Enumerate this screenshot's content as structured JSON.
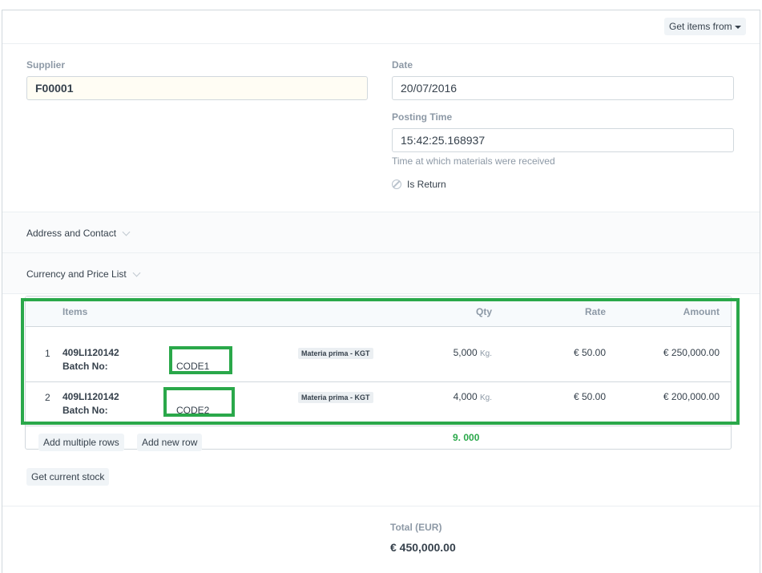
{
  "toolbar": {
    "get_items_label": "Get items from"
  },
  "supplier": {
    "label": "Supplier",
    "value": "F00001"
  },
  "date": {
    "label": "Date",
    "value": "20/07/2016"
  },
  "posting_time": {
    "label": "Posting Time",
    "value": "15:42:25.168937",
    "help": "Time at which materials were received"
  },
  "is_return": {
    "label": "Is Return",
    "checked": false
  },
  "sections": {
    "address": "Address and Contact",
    "currency": "Currency and Price List"
  },
  "items_table": {
    "headers": {
      "items": "Items",
      "qty": "Qty",
      "rate": "Rate",
      "amount": "Amount"
    },
    "rows": [
      {
        "no": "1",
        "item_code": "409LI120142",
        "batch_label": "Batch No:",
        "batch_no": "CODE1",
        "warehouse": "Materia prima - KGT",
        "qty": "5,000",
        "uom": "Kg.",
        "rate": "€ 50.00",
        "amount": "€ 250,000.00"
      },
      {
        "no": "2",
        "item_code": "409LI120142",
        "batch_label": "Batch No:",
        "batch_no": "CODE2",
        "warehouse": "Materia prima - KGT",
        "qty": "4,000",
        "uom": "Kg.",
        "rate": "€ 50.00",
        "amount": "€ 200,000.00"
      }
    ],
    "add_multiple_label": "Add multiple rows",
    "add_row_label": "Add new row",
    "total_qty": "9. 000"
  },
  "get_stock_label": "Get current stock",
  "totals": {
    "label": "Total (EUR)",
    "value": "€ 450,000.00"
  },
  "colors": {
    "highlight": "#2aa84a",
    "border": "#d1d8dd",
    "muted_text": "#8d99a6"
  }
}
